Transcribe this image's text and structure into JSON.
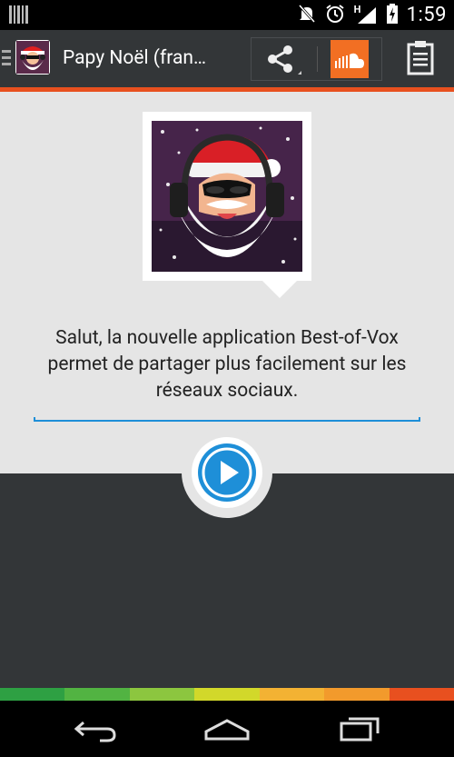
{
  "status_bar": {
    "time": "1:59",
    "network_label": "H"
  },
  "action_bar": {
    "title": "Papy Noël (fran…",
    "accent_color": "#e8501f"
  },
  "content": {
    "caption": "Salut, la nouvelle application Best-of-Vox permet de partager plus facilement sur les réseaux sociaux."
  },
  "colors": {
    "action_bar_bg": "#333638",
    "content_bg": "#e5e5e5",
    "play_blue": "#1e8fd8",
    "soundcloud_orange": "#f26f23",
    "strip": [
      "#2ea043",
      "#52b342",
      "#8cc63f",
      "#d2d82a",
      "#f3b233",
      "#f29a2c",
      "#e8501f"
    ]
  }
}
